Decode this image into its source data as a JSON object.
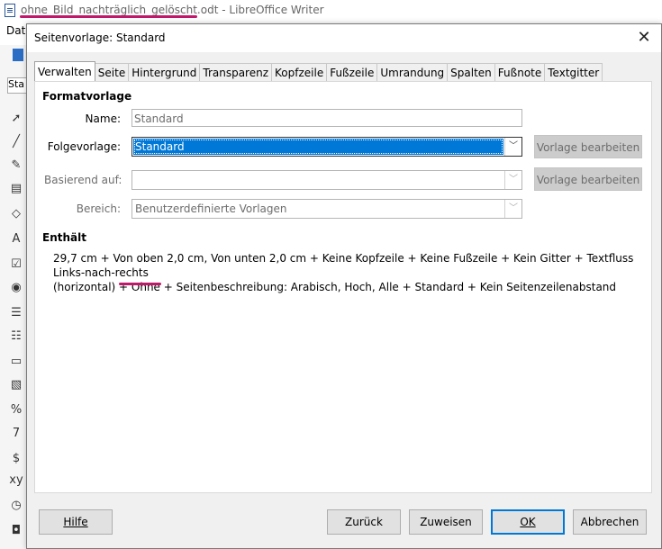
{
  "app": {
    "title_filename": "ohne_Bild_nachträglich_gelöscht.odt",
    "title_suffix": " - LibreOffice Writer",
    "menu_first": "Datei",
    "paragraph_style_box": "Sta",
    "accent_color": "#c0186a"
  },
  "dialog": {
    "title": "Seitenvorlage: Standard",
    "close_glyph": "✕",
    "tabs": [
      "Verwalten",
      "Seite",
      "Hintergrund",
      "Transparenz",
      "Kopfzeile",
      "Fußzeile",
      "Umrandung",
      "Spalten",
      "Fußnote",
      "Textgitter"
    ],
    "active_tab": "Verwalten",
    "formatvorlage": {
      "heading": "Formatvorlage",
      "name_label": "Name:",
      "name_value": "Standard",
      "folge_label": "Folgevorlage:",
      "folge_value": "Standard",
      "basiert_label": "Basierend auf:",
      "basiert_value": "",
      "bereich_label": "Bereich:",
      "bereich_value": "Benutzerdefinierte Vorlagen",
      "edit_button_1": "Vorlage bearbeiten",
      "edit_button_2": "Vorlage bearbeiten"
    },
    "contains": {
      "heading": "Enthält",
      "text_line1": "29,7 cm + Von oben 2,0 cm, Von unten 2,0 cm + Keine Kopfzeile + Keine Fußzeile + Kein Gitter + Textfluss Links-nach-rechts",
      "text_line2": "(horizontal) + Ohne + Seitenbeschreibung: Arabisch, Hoch, Alle + Standard + Kein Seitenzeilenabstand"
    },
    "buttons": {
      "help": "Hilfe",
      "back": "Zurück",
      "reset": "Zuweisen",
      "ok": "OK",
      "cancel": "Abbrechen"
    }
  }
}
